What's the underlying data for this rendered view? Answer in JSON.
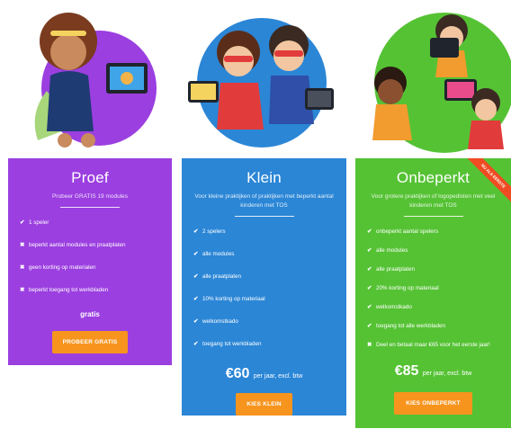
{
  "plans": {
    "proef": {
      "title": "Proef",
      "subtitle": "Probeer GRATIS 19 modules",
      "features": [
        {
          "mark": "✔",
          "text": "1 speler"
        },
        {
          "mark": "✖",
          "text": "beperkt aantal modules en praatplaten"
        },
        {
          "mark": "✖",
          "text": "geen korting op materialen"
        },
        {
          "mark": "✖",
          "text": "beperkt toegang tot werkbladen"
        }
      ],
      "price_text": "gratis",
      "button": "PROBEER GRATIS",
      "color": "#9b3fe0"
    },
    "klein": {
      "title": "Klein",
      "subtitle": "Voor kleine praktijken of praktijken met beperkt aantal kinderen met TOS",
      "features": [
        {
          "mark": "✔",
          "text": "2 spelers"
        },
        {
          "mark": "✔",
          "text": "alle modules"
        },
        {
          "mark": "✔",
          "text": "alle praatplaten"
        },
        {
          "mark": "✔",
          "text": "10% korting op materiaal"
        },
        {
          "mark": "✔",
          "text": "welkomstkado"
        },
        {
          "mark": "✔",
          "text": "toegang tot werkbladen"
        }
      ],
      "price_amount": "€60",
      "price_suffix": "per jaar, excl. btw",
      "button": "KIES KLEIN",
      "color": "#2b86d6"
    },
    "onbeperkt": {
      "title": "Onbeperkt",
      "subtitle": "Voor grotere praktijken of logopedisten met veel kinderen met TOS",
      "ribbon": "NU ALS EERSTE",
      "features": [
        {
          "mark": "✔",
          "text": "onbeperkt aantal spelers"
        },
        {
          "mark": "✔",
          "text": "alle modules"
        },
        {
          "mark": "✔",
          "text": "alle praatplaten"
        },
        {
          "mark": "✔",
          "text": "20% korting op materiaal"
        },
        {
          "mark": "✔",
          "text": "welkomstkado"
        },
        {
          "mark": "✔",
          "text": "toegang tot alle werkbladen"
        },
        {
          "mark": "✖",
          "text": "Deel en betaal maar €65 voor het eerste jaar!"
        }
      ],
      "price_amount": "€85",
      "price_suffix": "per jaar, excl. btw",
      "button": "KIES ONBEPERKT",
      "color": "#55c234"
    }
  },
  "illustrations": {
    "proef": "girl-superhero-with-tablet-icon",
    "klein": "two-kids-superheroes-high-five-icon",
    "onbeperkt": "group-of-kids-superheroes-with-tablets-icon"
  },
  "accent": "#f7941d"
}
